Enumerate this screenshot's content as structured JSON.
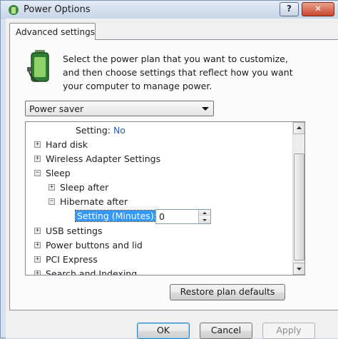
{
  "window": {
    "title": "Power Options",
    "help_label": "?",
    "close_label": "✕"
  },
  "tab": {
    "label": "Advanced settings"
  },
  "description": "Select the power plan that you want to customize, and then choose settings that reflect how you want your computer to manage power.",
  "plan": {
    "selected": "Power saver"
  },
  "tree": {
    "top_setting_label": "Setting:",
    "top_setting_value": "No",
    "items": [
      {
        "label": "Hard disk",
        "expander": "⊞"
      },
      {
        "label": "Wireless Adapter Settings",
        "expander": "⊞"
      },
      {
        "label": "Sleep",
        "expander": "⊟"
      },
      {
        "label": "Sleep after",
        "expander": "⊞"
      },
      {
        "label": "Hibernate after",
        "expander": "⊟"
      },
      {
        "label": "USB settings",
        "expander": "⊞"
      },
      {
        "label": "Power buttons and lid",
        "expander": "⊞"
      },
      {
        "label": "PCI Express",
        "expander": "⊞"
      },
      {
        "label": "Search and Indexing",
        "expander": "⊞"
      }
    ],
    "edit_label": "Setting (Minutes):",
    "edit_value": "0"
  },
  "buttons": {
    "restore": "Restore plan defaults",
    "ok": "OK",
    "cancel": "Cancel",
    "apply": "Apply"
  },
  "icons": [
    "window-app-icon",
    "battery-plug-icon",
    "dropdown-arrow-icon",
    "expand-icon",
    "collapse-icon",
    "spin-up-icon",
    "spin-down-icon",
    "scroll-up-icon",
    "scroll-down-icon"
  ],
  "colors": {
    "accent": "#3399ff",
    "setting_value": "#2a5db0",
    "close_button": "#c9462c"
  }
}
